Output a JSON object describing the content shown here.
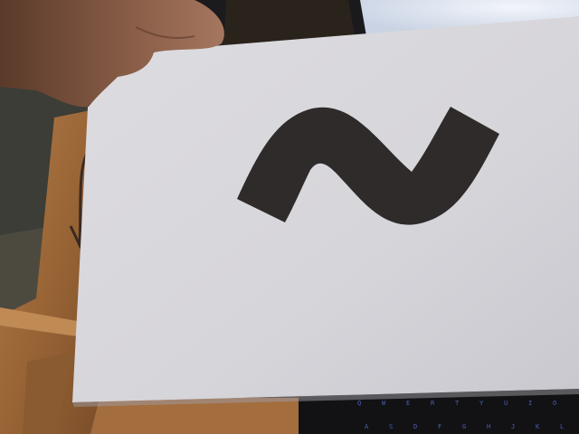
{
  "scene": {
    "description_type": "photo",
    "colors": {
      "paper": "#d9d8dc",
      "paper_shadow": "#bdbcc2",
      "symbol": "#2e2b2a",
      "desk": "#a06a3c",
      "desk_dark": "#6e4424",
      "carpet": "#3b3d36",
      "monitor_screen": "#dfe6f1",
      "keyboard": "#121214",
      "key_glyph": "#4a5fb5",
      "skin": "#7a5240"
    }
  },
  "keyboard": {
    "keys": [
      "Q",
      "W",
      "E",
      "R",
      "T",
      "Y",
      "U",
      "I",
      "O",
      "P",
      "A",
      "S",
      "D",
      "F",
      "G",
      "H",
      "J",
      "K",
      "L"
    ]
  }
}
